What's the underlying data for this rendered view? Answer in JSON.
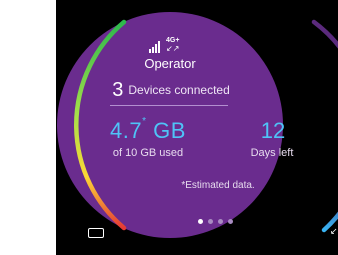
{
  "status": {
    "network_type": "4G+",
    "data_arrows": "↙↗",
    "operator": "Operator"
  },
  "devices": {
    "count": "3",
    "label": "Devices connected"
  },
  "usage": {
    "amount": "4.7",
    "estimate_mark": "*",
    "unit": "GB",
    "subtitle": "of 10 GB used",
    "used_fraction": 0.47
  },
  "plan": {
    "days": "12",
    "days_label": "Days left"
  },
  "note": "*Estimated data.",
  "pager": {
    "total": 4,
    "active": 1
  },
  "colors": {
    "circle": "#6a2c8e",
    "accent_blue": "#4fc3f7",
    "gauge_gradient": [
      "#e53935",
      "#fdd835",
      "#7ed957",
      "#2db84c"
    ]
  },
  "icons": [
    "signal-bars-icon",
    "back-button-icon",
    "recent-apps-icon"
  ]
}
